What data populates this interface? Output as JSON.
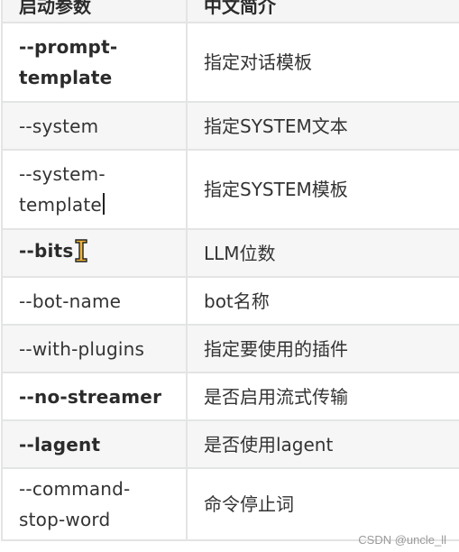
{
  "table": {
    "headers": [
      "启动参数",
      "中文简介"
    ],
    "rows": [
      {
        "param": "--prompt-template",
        "param_lines": [
          "--prompt-",
          "template"
        ],
        "desc": "指定对话模板",
        "bold": true
      },
      {
        "param": "--system",
        "desc": "指定SYSTEM文本",
        "bold": false
      },
      {
        "param": "--system-template",
        "param_lines": [
          "--system-",
          "template"
        ],
        "desc": "指定SYSTEM模板",
        "bold": false
      },
      {
        "param": "--bits",
        "desc": "LLM位数",
        "bold": true
      },
      {
        "param": "--bot-name",
        "desc": "bot名称",
        "bold": false
      },
      {
        "param": "--with-plugins",
        "desc": "指定要使用的插件",
        "bold": false
      },
      {
        "param": "--no-streamer",
        "desc": "是否启用流式传输",
        "bold": true
      },
      {
        "param": "--lagent",
        "desc": "是否使用lagent",
        "bold": true
      },
      {
        "param": "--command-stop-word",
        "param_lines": [
          "--command-",
          "stop-word"
        ],
        "desc": "命令停止词",
        "bold": false
      }
    ]
  },
  "icons": {
    "text_cursor": "text-caret",
    "mouse_cursor": "i-beam-cursor-icon"
  },
  "colors": {
    "border": "#e3e4e4",
    "header_bg": "#f5f5f6",
    "stripe_bg": "#f6f6f6",
    "text": "#333333",
    "cursor_fill": "#f0b43a"
  },
  "watermark": "CSDN @uncle_ll"
}
